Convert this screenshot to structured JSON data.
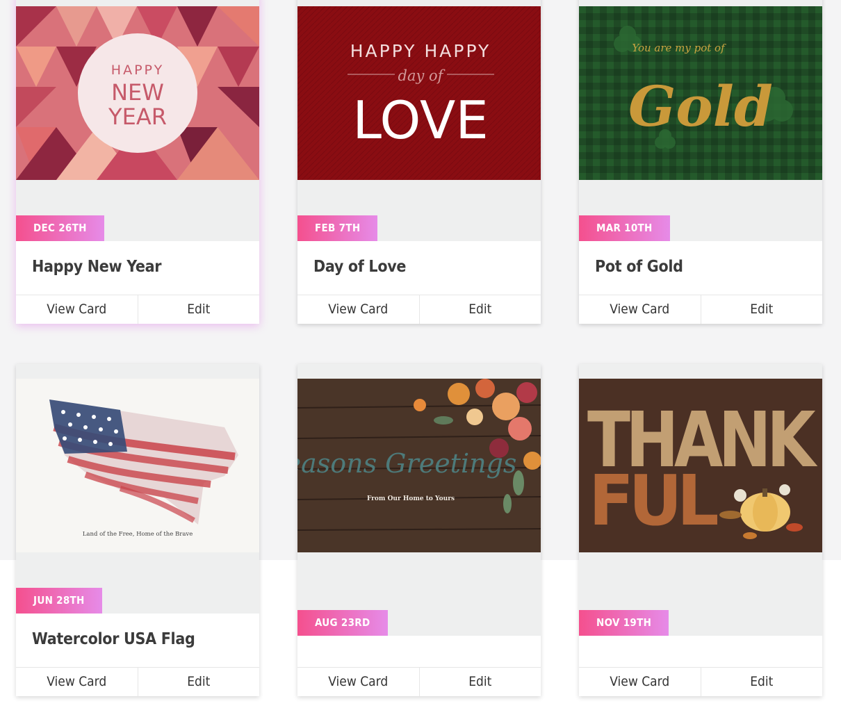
{
  "colors": {
    "badge_gradient_start": "#f4508e",
    "badge_gradient_end": "#e68be8",
    "page_background": "#f4f4f5",
    "card_band": "#eeefef",
    "title_text": "#3b3b3b"
  },
  "cards": [
    {
      "date": "DEC 26TH",
      "title": "Happy New Year",
      "view_label": "View Card",
      "edit_label": "Edit",
      "image": {
        "line1": "HAPPY",
        "line2": "NEW",
        "line3": "YEAR"
      }
    },
    {
      "date": "FEB 7TH",
      "title": "Day of Love",
      "view_label": "View Card",
      "edit_label": "Edit",
      "image": {
        "line1": "HAPPY HAPPY",
        "line2": "day of",
        "line3": "LOVE"
      }
    },
    {
      "date": "MAR 10TH",
      "title": "Pot of Gold",
      "view_label": "View Card",
      "edit_label": "Edit",
      "image": {
        "line1": "You are my pot of",
        "line2": "Gold"
      }
    },
    {
      "date": "JUN 28TH",
      "title": "Watercolor USA Flag",
      "view_label": "View Card",
      "edit_label": "Edit",
      "image": {
        "caption": "Land of the Free, Home of the Brave"
      }
    },
    {
      "date": "AUG 23RD",
      "title": "",
      "view_label": "View Card",
      "edit_label": "Edit",
      "image": {
        "line1": "Seasons Greetings",
        "line2": "From Our Home to Yours"
      }
    },
    {
      "date": "NOV 19TH",
      "title": "",
      "view_label": "View Card",
      "edit_label": "Edit",
      "image": {
        "line1": "THANK",
        "line2": "FUL"
      }
    }
  ]
}
